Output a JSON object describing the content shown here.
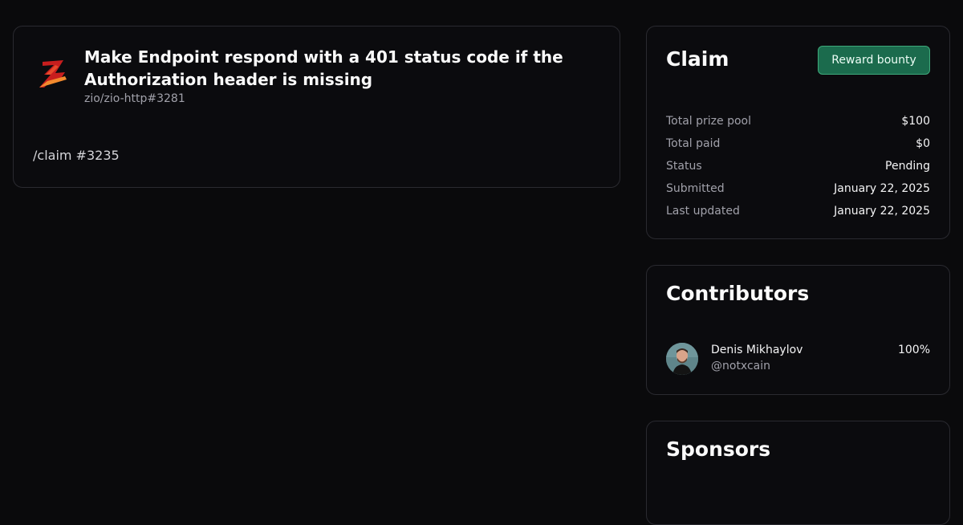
{
  "issue": {
    "title": "Make Endpoint respond with a 401 status code if the Authorization header is missing",
    "ref": "zio/zio-http#3281",
    "claim_text": "/claim #3235",
    "logo_icon": "zio-logo-icon"
  },
  "claim": {
    "title": "Claim",
    "reward_button_label": "Reward bounty",
    "rows": [
      {
        "label": "Total prize pool",
        "value": "$100"
      },
      {
        "label": "Total paid",
        "value": "$0"
      },
      {
        "label": "Status",
        "value": "Pending"
      },
      {
        "label": "Submitted",
        "value": "January 22, 2025"
      },
      {
        "label": "Last updated",
        "value": "January 22, 2025"
      }
    ]
  },
  "contributors": {
    "title": "Contributors",
    "items": [
      {
        "name": "Denis Mikhaylov",
        "handle": "@notxcain",
        "share": "100%"
      }
    ]
  },
  "sponsors": {
    "title": "Sponsors"
  },
  "colors": {
    "background": "#0a0a0c",
    "accent_button": "#1b6b4d",
    "accent_border": "#3ea97a"
  }
}
